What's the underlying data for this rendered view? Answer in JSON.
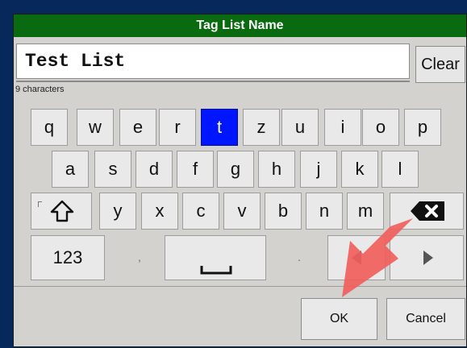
{
  "dialog": {
    "title": "Tag List Name",
    "input_value": "Test List",
    "char_count": "9 characters",
    "clear_label": "Clear"
  },
  "keyboard": {
    "row1": [
      "q",
      "w",
      "e",
      "r",
      "t",
      "z",
      "u",
      "i",
      "o",
      "p"
    ],
    "row2": [
      "a",
      "s",
      "d",
      "f",
      "g",
      "h",
      "j",
      "k",
      "l"
    ],
    "row3": [
      "y",
      "x",
      "c",
      "v",
      "b",
      "n",
      "m"
    ],
    "row4": {
      "mode_label": "123",
      "comma": ",",
      "period": "."
    },
    "active_key": "t"
  },
  "footer": {
    "ok_label": "OK",
    "cancel_label": "Cancel"
  },
  "colors": {
    "title_bg": "#0a6a10",
    "active_key": "#0016ff",
    "arrow": "#f0605c"
  },
  "icons": [
    "shift-icon",
    "backspace-icon",
    "space-icon",
    "arrow-left-icon",
    "arrow-right-icon",
    "pointer-arrow-icon"
  ]
}
